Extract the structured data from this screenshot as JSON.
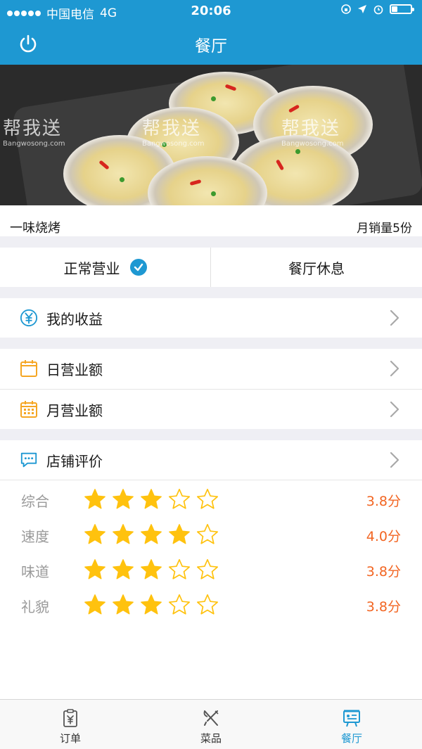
{
  "status_bar": {
    "carrier": "中国电信",
    "network": "4G",
    "time": "20:06"
  },
  "nav": {
    "title": "餐厅"
  },
  "banner": {
    "watermark_text": "帮我送",
    "watermark_sub": "Bangwosong.com"
  },
  "restaurant": {
    "name": "一味烧烤",
    "monthly_sales": "月销量5份"
  },
  "status_toggle": {
    "open_label": "正常营业",
    "closed_label": "餐厅休息"
  },
  "menu": {
    "earnings": "我的收益",
    "daily_revenue": "日营业额",
    "monthly_revenue": "月营业额",
    "reviews": "店铺评价"
  },
  "ratings": [
    {
      "label": "综合",
      "stars": 3,
      "score": "3.8分"
    },
    {
      "label": "速度",
      "stars": 4,
      "score": "4.0分"
    },
    {
      "label": "味道",
      "stars": 3,
      "score": "3.8分"
    },
    {
      "label": "礼貌",
      "stars": 3,
      "score": "3.8分"
    }
  ],
  "tabs": [
    {
      "label": "订单",
      "icon": "order-icon",
      "active": false
    },
    {
      "label": "菜品",
      "icon": "dishes-icon",
      "active": false
    },
    {
      "label": "餐厅",
      "icon": "restaurant-icon",
      "active": true
    }
  ],
  "colors": {
    "primary": "#1e98d2",
    "star": "#ffc20e",
    "score": "#f26522",
    "calendar": "#f5a623"
  }
}
